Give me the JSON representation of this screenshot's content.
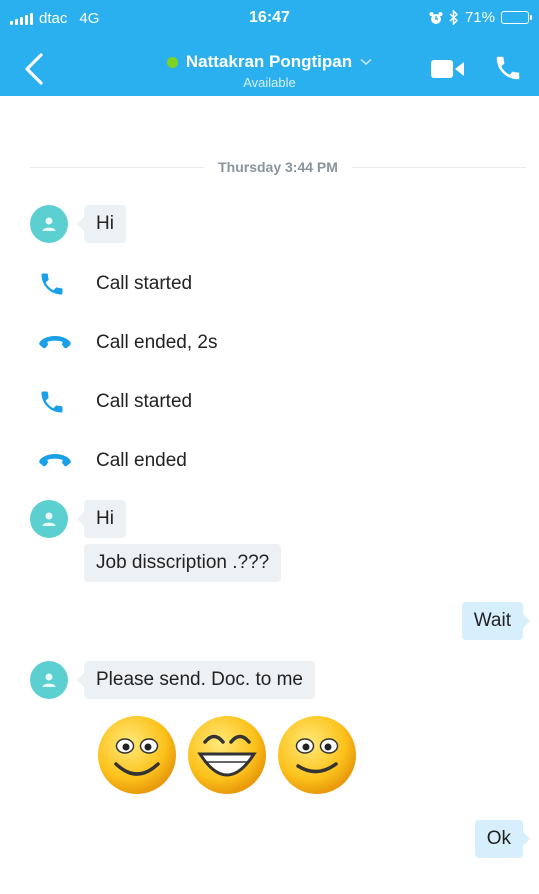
{
  "status_bar": {
    "carrier": "dtac",
    "network": "4G",
    "time": "16:47",
    "battery": "71%",
    "battery_level": 0.71
  },
  "header": {
    "contact_name": "Nattakran Pongtipan",
    "presence": "Available",
    "presence_color": "#7ed321",
    "accent_color": "#2ab0ee"
  },
  "conversation": {
    "date_divider": "Thursday 3:44 PM",
    "msg_hi_1": "Hi",
    "call_1": "Call started",
    "call_2": "Call ended, 2s",
    "call_3": "Call started",
    "call_4": "Call ended",
    "msg_hi_2": "Hi",
    "msg_job": "Job disscription .???",
    "reply_wait": "Wait",
    "msg_please": "Please send. Doc. to me",
    "emoticons": [
      "smile-emoji",
      "laugh-emoji",
      "smile-emoji"
    ],
    "reply_ok": "Ok"
  },
  "icons": {
    "back": "chevron-left-icon",
    "video": "video-camera-icon",
    "call": "phone-icon",
    "call_started": "phone-icon",
    "call_ended": "phone-hangup-icon",
    "avatar": "person-icon"
  }
}
